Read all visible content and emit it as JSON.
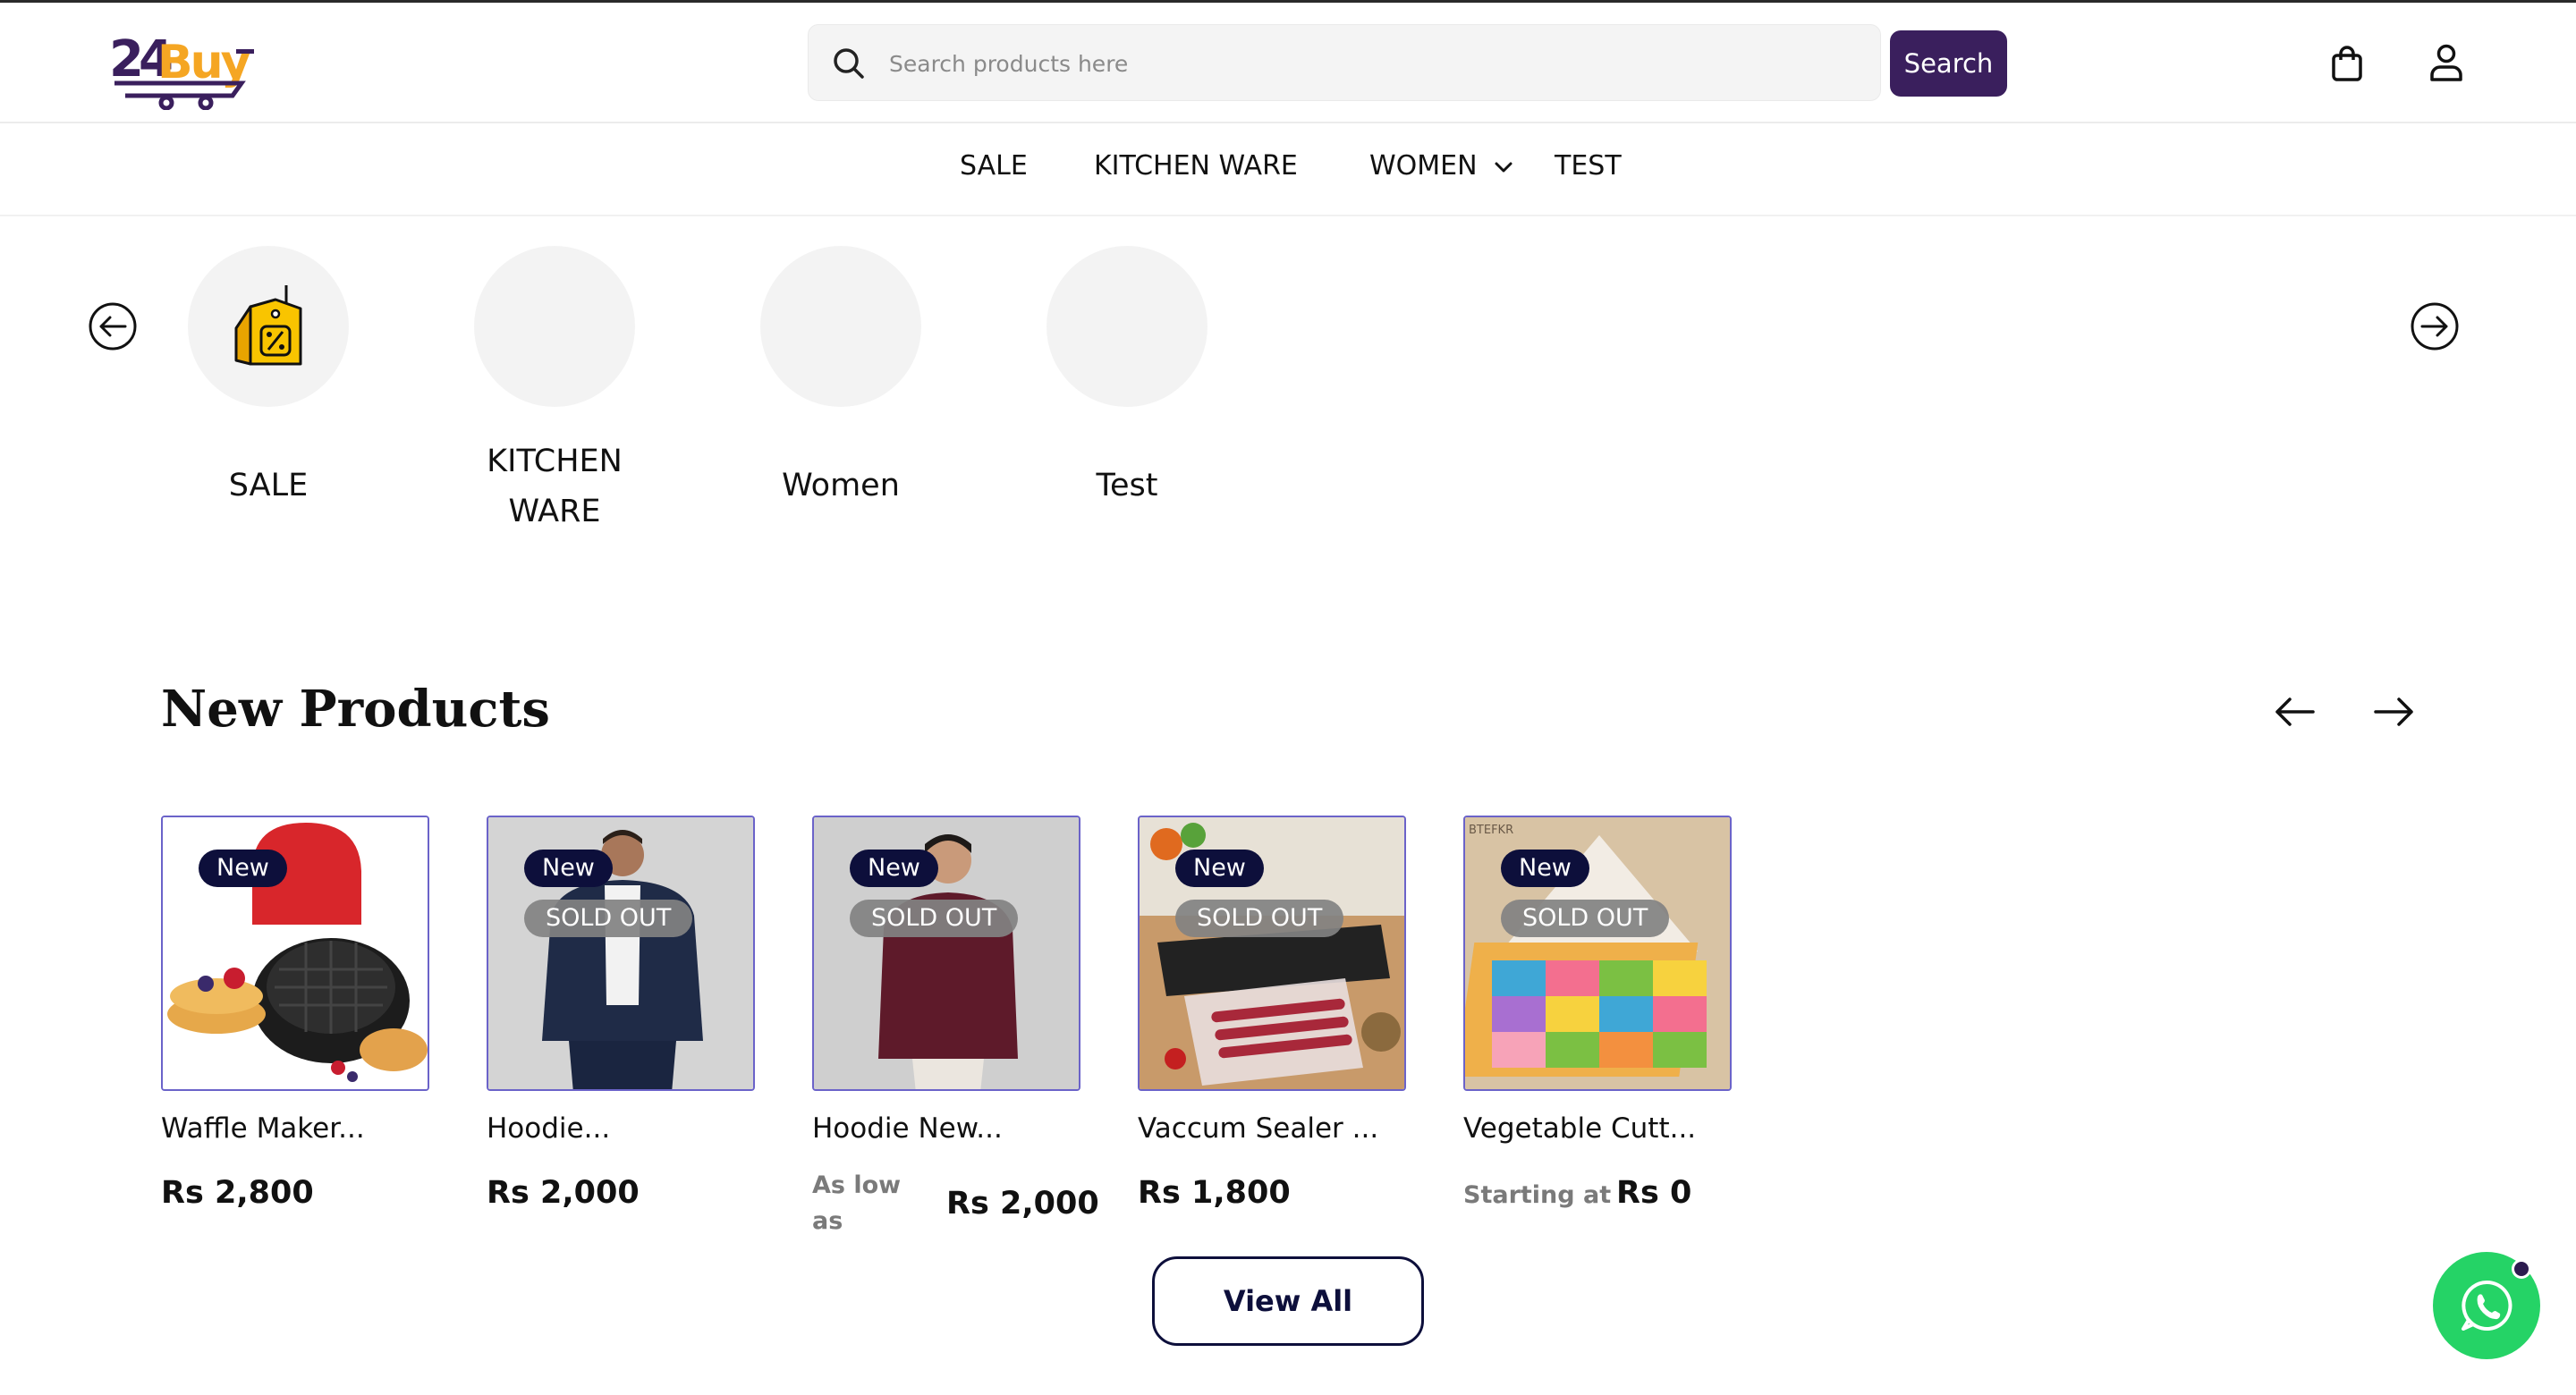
{
  "header": {
    "logo_text": "24Buy",
    "search": {
      "placeholder": "Search products here",
      "value": ""
    },
    "search_button_label": "Search",
    "icons": [
      "search-icon",
      "shopping-bag-icon",
      "user-icon"
    ]
  },
  "nav": {
    "items": [
      {
        "label": "SALE"
      },
      {
        "label": "KITCHEN WARE"
      },
      {
        "label": "WOMEN",
        "has_dropdown": true
      },
      {
        "label": "TEST"
      }
    ]
  },
  "categories": {
    "items": [
      {
        "label": "SALE",
        "icon": "sale-tag-icon"
      },
      {
        "label": "KITCHEN WARE",
        "label_line1": "KITCHEN",
        "label_line2": "WARE"
      },
      {
        "label": "Women"
      },
      {
        "label": "Test"
      }
    ]
  },
  "new_products": {
    "title": "New Products",
    "view_all_label": "View All",
    "products": [
      {
        "name": "Waffle Maker...",
        "badge": "New",
        "sold_out": "",
        "price_prefix": "",
        "price": "Rs 2,800"
      },
      {
        "name": "Hoodie...",
        "badge": "New",
        "sold_out": "SOLD OUT",
        "price_prefix": "",
        "price": "Rs 2,000"
      },
      {
        "name": "Hoodie New...",
        "badge": "New",
        "sold_out": "SOLD OUT",
        "price_prefix": "As low as",
        "price_prefix_line1": "As low",
        "price_prefix_line2": "as",
        "price": "Rs 2,000"
      },
      {
        "name": "Vaccum Sealer ...",
        "badge": "New",
        "sold_out": "SOLD OUT",
        "price_prefix": "",
        "price": "Rs 1,800"
      },
      {
        "name": "Vegetable Cutt...",
        "badge": "New",
        "sold_out": "SOLD OUT",
        "price_prefix": "Starting at",
        "price": "Rs 0",
        "image_text": "BTEFKR"
      }
    ]
  },
  "colors": {
    "brand_purple": "#3a1f5d",
    "logo_gold": "#f5a623",
    "badge_navy": "#0d0f3b",
    "card_border": "#6b63c9",
    "whatsapp_green": "#25d366"
  }
}
